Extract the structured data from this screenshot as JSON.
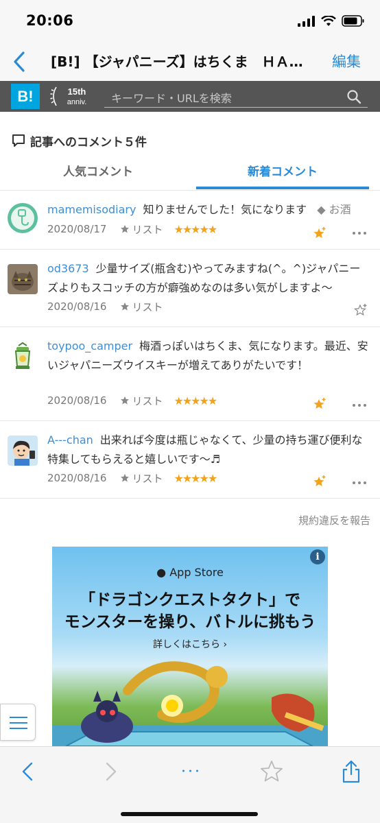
{
  "status": {
    "time": "20:06"
  },
  "nav": {
    "title": "[B!] 【ジャパニーズ】はちくま　ＨＡ…",
    "edit_label": "編集"
  },
  "hatena": {
    "logo": "B!",
    "anniv_top": "15th",
    "anniv_bottom": "anniv.",
    "search_placeholder": "キーワード・URLを検索"
  },
  "comments_header": {
    "title": "記事へのコメント５件"
  },
  "tabs": [
    {
      "label": "人気コメント"
    },
    {
      "label": "新着コメント"
    }
  ],
  "comments": [
    {
      "user": "mamemisodiary",
      "text": "知りませんでした！気になります",
      "tag": "お酒",
      "date": "2020/08/17",
      "list_label": "リスト",
      "stars": "★★★★★"
    },
    {
      "user": "od3673",
      "text": "少量サイズ(瓶含む)やってみますね(^。^)ジャパニーズよりもスコッチの方が癖強めなのは多い気がしますよ～",
      "tag": "",
      "date": "2020/08/16",
      "list_label": "リスト",
      "stars": ""
    },
    {
      "user": "toypoo_camper",
      "text": "梅酒っぽいはちくま、気になります。最近、安いジャパニーズウイスキーが増えてありがたいです！",
      "tag": "",
      "date": "2020/08/16",
      "list_label": "リスト",
      "stars": "★★★★★"
    },
    {
      "user": "A---chan",
      "text": "出来れば今度は瓶じゃなくて、少量の持ち運び便利な特集してもらえると嬉しいです～♬",
      "tag": "",
      "date": "2020/08/16",
      "list_label": "リスト",
      "stars": "★★★★★"
    }
  ],
  "report_label": "規約違反を報告",
  "ad": {
    "info": "i",
    "store": " App Store",
    "line1": "「ドラゴンクエストタクト」で",
    "line2": "モンスターを操り、バトルに挑もう",
    "cta": "詳しくはこちら ›"
  },
  "toolbar": {
    "more_label": "･･･"
  },
  "colors": {
    "accent": "#2a8ad6",
    "hatena_blue": "#00a4de",
    "star": "#f3a31b",
    "bar": "#555555"
  }
}
